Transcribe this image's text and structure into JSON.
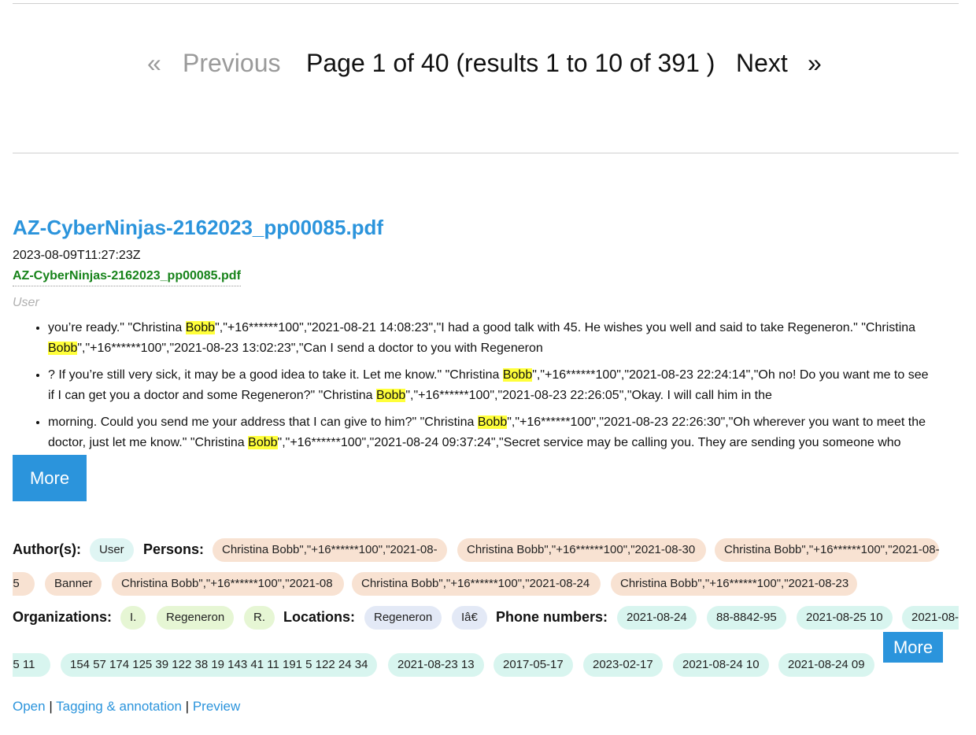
{
  "pagination": {
    "first_symbol": "«",
    "previous_label": "Previous",
    "status_text": "Page 1 of 40 (results 1 to 10 of 391 )",
    "next_label": "Next",
    "last_symbol": "»"
  },
  "result": {
    "title": "AZ-CyberNinjas-2162023_pp00085.pdf",
    "date": "2023-08-09T11:27:23Z",
    "file_link": "AZ-CyberNinjas-2162023_pp00085.pdf",
    "author_line": "User",
    "snippets": [
      {
        "lines": [
          [
            {
              "t": "you’re ready.\" \"Christina ",
              "hl": false
            },
            {
              "t": "Bobb",
              "hl": true
            },
            {
              "t": "\",\"+16******100\",\"2021-08-21 14:08:23\",\"I had a good talk with 45. He wishes you well and said to take Regeneron.\" \"Christina",
              "hl": false
            }
          ],
          [
            {
              "t": "Bobb",
              "hl": true
            },
            {
              "t": "\",\"+16******100\",\"2021-08-23 13:02:23\",\"Can I send a doctor to you with Regeneron",
              "hl": false
            }
          ]
        ]
      },
      {
        "lines": [
          [
            {
              "t": "? If you’re still very sick, it may be a good idea to take it. Let me know.\" \"Christina ",
              "hl": false
            },
            {
              "t": "Bobb",
              "hl": true
            },
            {
              "t": "\",\"+16******100\",\"2021-08-23 22:24:14\",\"Oh no! Do you want me to see",
              "hl": false
            }
          ],
          [
            {
              "t": "if I can get you a doctor and some Regeneron?\" \"Christina ",
              "hl": false
            },
            {
              "t": "Bobb",
              "hl": true
            },
            {
              "t": "\",\"+16******100\",\"2021-08-23 22:26:05\",\"Okay. I will call him in the",
              "hl": false
            }
          ]
        ]
      },
      {
        "lines": [
          [
            {
              "t": "morning. Could you send me your address that I can give to him?\" \"Christina ",
              "hl": false
            },
            {
              "t": "Bobb",
              "hl": true
            },
            {
              "t": "\",\"+16******100\",\"2021-08-23 22:26:30\",\"Oh wherever you want to meet the",
              "hl": false
            }
          ],
          [
            {
              "t": "doctor, just let me know.\" \"Christina ",
              "hl": false
            },
            {
              "t": "Bobb",
              "hl": true
            },
            {
              "t": "\",\"+16******100\",\"2021-08-24 09:37:24\",\"Secret service may be calling you. They are sending you someone who",
              "hl": false
            }
          ]
        ]
      }
    ],
    "more_label": "More"
  },
  "facets": {
    "authors_label": "Author(s):",
    "authors": [
      "User"
    ],
    "persons_label": "Persons:",
    "persons_row1": [
      "Christina Bobb\",\"+16******100\",\"2021-08-",
      "Christina Bobb\",\"+16******100\",\"2021-08-30",
      "Christina Bobb\",\"+16******100\",\"2021-08-"
    ],
    "persons_row2": [
      "25",
      "Banner",
      "Christina Bobb\",\"+16******100\",\"2021-08",
      "Christina Bobb\",\"+16******100\",\"2021-08-24",
      "Christina Bobb\",\"+16******100\",\"2021-08-23"
    ],
    "organizations_label": "Organizations:",
    "organizations": [
      "I.",
      "Regeneron",
      "R."
    ],
    "locations_label": "Locations:",
    "locations": [
      "Regeneron",
      "Iâ€"
    ],
    "phones_label": "Phone numbers:",
    "phones_row1": [
      "2021-08-24",
      "88-8842-95",
      "2021-08-25 10",
      "2021-08-"
    ],
    "phones_row2": [
      "25 11",
      "154 57 174 125 39 122 38 19 143 41 11 191 5 122 24 34",
      "2021-08-23 13",
      "2017-05-17",
      "2023-02-17",
      "2021-08-24 10",
      "2021-08-24 09"
    ],
    "more_label": "More"
  },
  "actions": {
    "open_label": "Open",
    "separator": "|",
    "tagging_label": "Tagging & annotation",
    "preview_label": "Preview"
  },
  "colors": {
    "link_blue": "#2b94dc",
    "file_green": "#17831a",
    "highlight": "#ffff3a"
  }
}
